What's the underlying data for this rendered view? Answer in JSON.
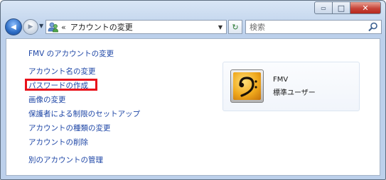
{
  "window": {
    "caption": {
      "minimize_glyph": "▭",
      "maximize_glyph": "□",
      "close_glyph": "✕"
    }
  },
  "nav": {
    "back_glyph": "◀",
    "forward_glyph": "▶",
    "history_glyph": "▼",
    "address": {
      "chevron": "«",
      "text": "アカウントの変更",
      "dropdown_glyph": "▼",
      "icon": "user-accounts-icon"
    },
    "refresh_glyph": "↻",
    "refresh_icon": "refresh-icon",
    "search_placeholder": "検索",
    "search_icon": "search-icon"
  },
  "tasks": {
    "title": "FMV のアカウントの変更",
    "items": [
      "アカウント名の変更",
      "パスワードの作成",
      "画像の変更",
      "保護者による制限のセットアップ",
      "アカウントの種類の変更",
      "アカウントの削除"
    ],
    "manage_other": "別のアカウントの管理",
    "highlighted_item": "パスワードの作成",
    "highlight_color": "#e8121b"
  },
  "user": {
    "name": "FMV",
    "type": "標準ユーザー",
    "picture_icon": "bass-clef-icon"
  },
  "colors": {
    "link": "#1e46a6",
    "chrome": "#c5d7ee"
  }
}
